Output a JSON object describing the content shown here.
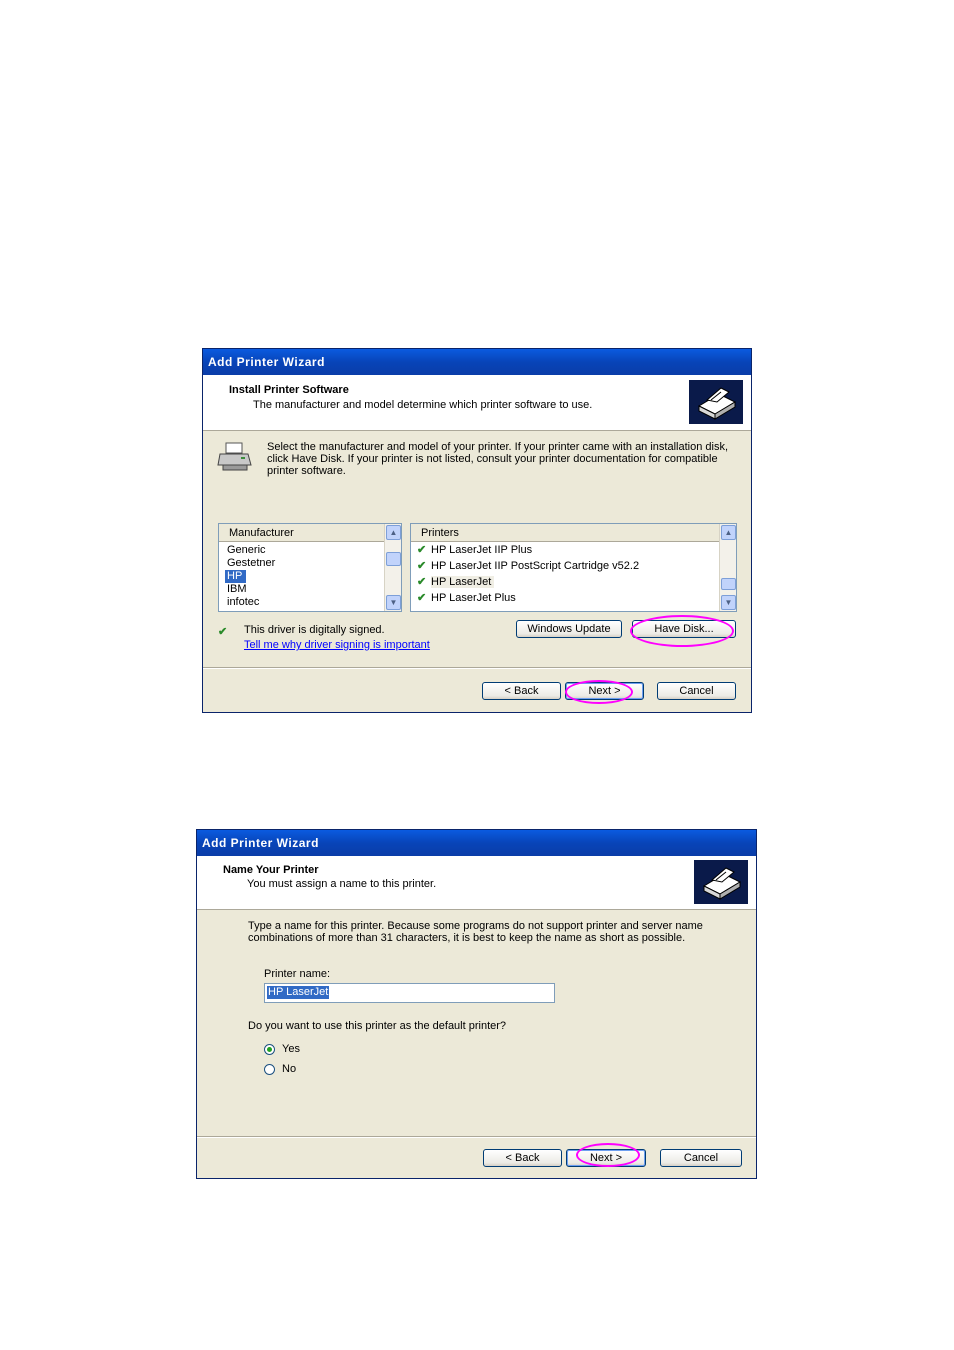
{
  "dialog1": {
    "title": "Add Printer Wizard",
    "header_title": "Install Printer Software",
    "header_subtitle": "The manufacturer and model determine which printer software to use.",
    "instructions": "Select the manufacturer and model of your printer. If your printer came with an installation disk, click Have Disk. If your printer is not listed, consult your printer documentation for compatible printer software.",
    "manufacturer_header": "Manufacturer",
    "manufacturers": [
      "Generic",
      "Gestetner",
      "HP",
      "IBM",
      "infotec"
    ],
    "selected_manufacturer": "HP",
    "printers_header": "Printers",
    "printers": [
      "HP LaserJet IIP Plus",
      "HP LaserJet IIP PostScript Cartridge v52.2",
      "HP LaserJet",
      "HP LaserJet Plus"
    ],
    "selected_printer": "HP LaserJet",
    "signed_text": "This driver is digitally signed.",
    "signing_link": "Tell me why driver signing is important",
    "windows_update_label": "Windows Update",
    "have_disk_label": "Have Disk...",
    "back_label": "< Back",
    "next_label": "Next >",
    "cancel_label": "Cancel"
  },
  "dialog2": {
    "title": "Add Printer Wizard",
    "header_title": "Name Your Printer",
    "header_subtitle": "You must assign a name to this printer.",
    "instructions": "Type a name for this printer. Because some programs do not support printer and server name combinations of more than 31 characters, it is best to keep the name as short as possible.",
    "printer_name_label": "Printer name:",
    "printer_name_value": "HP LaserJet",
    "default_question": "Do you want to use this printer as the default printer?",
    "yes_label": "Yes",
    "no_label": "No",
    "default_selected": "Yes",
    "back_label": "< Back",
    "next_label": "Next >",
    "cancel_label": "Cancel"
  },
  "icons": [
    "printer-wizard-icon",
    "printer-icon",
    "signed-driver-icon",
    "scroll-up-icon",
    "scroll-down-icon"
  ],
  "colors": {
    "titlebar": "#0a5be0",
    "dialog_bg": "#ece9d8",
    "highlight_circle": "#ff00ff",
    "selection": "#316ac5",
    "link": "#0000ff"
  }
}
